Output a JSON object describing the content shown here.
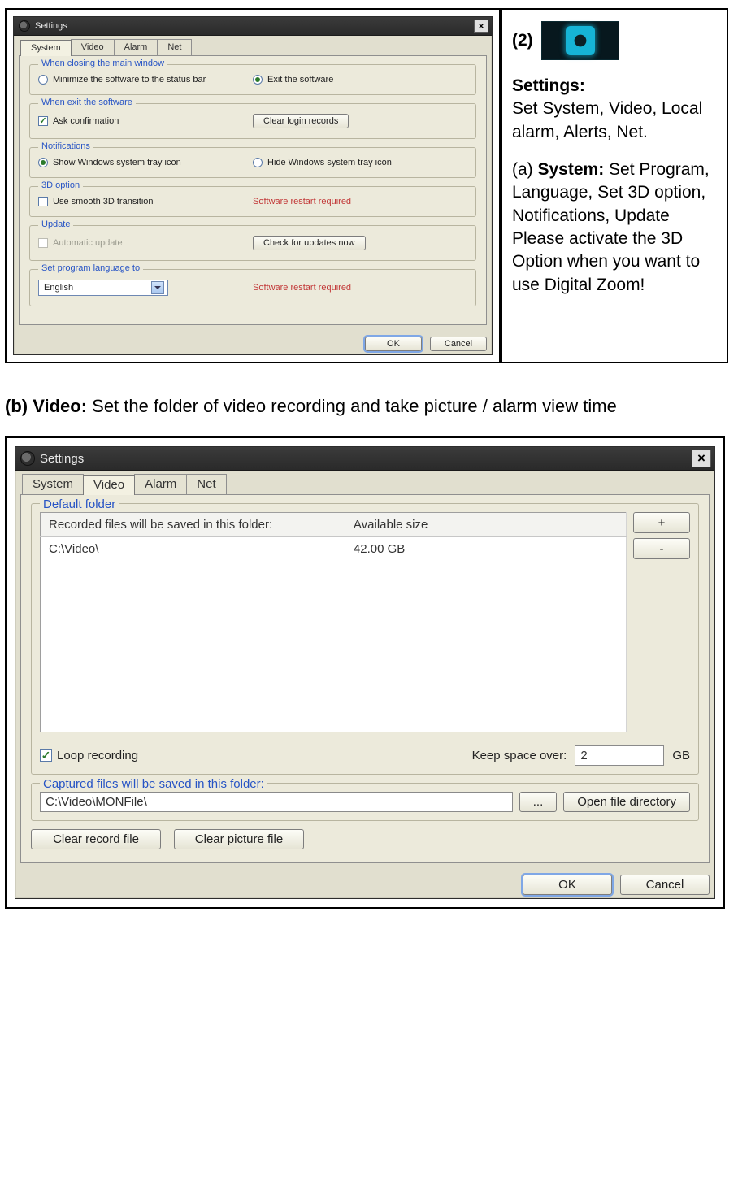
{
  "doc": {
    "item_num": "(2)",
    "settings_heading": "Settings:",
    "settings_line": "Set System, Video, Local alarm, Alerts, Net.",
    "system_label_a": "(a)  ",
    "system_bold": "System:",
    "system_rest": " Set Program, Language, Set 3D option, Notifications, Update Please activate the 3D Option when you want to use Digital Zoom!",
    "caption_b_prefix": "(b) Video:",
    "caption_b_rest": " Set the folder of video recording and take picture / alarm view time"
  },
  "win": {
    "title": "Settings",
    "close": "×",
    "ok": "OK",
    "cancel": "Cancel",
    "tabs": {
      "system": "System",
      "video": "Video",
      "alarm": "Alarm",
      "net": "Net"
    }
  },
  "system": {
    "g_close": "When closing the main window",
    "close_min": "Minimize the software to the status bar",
    "close_exit": "Exit the software",
    "g_exit": "When exit the software",
    "ask_confirm": "Ask confirmation",
    "clear_login": "Clear login records",
    "g_notif": "Notifications",
    "show_tray": "Show Windows system tray icon",
    "hide_tray": "Hide Windows system tray icon",
    "g_3d": "3D option",
    "smooth3d": "Use smooth 3D transition",
    "restart": "Software restart required",
    "g_update": "Update",
    "auto_update": "Automatic update",
    "check_update": "Check for updates now",
    "g_lang": "Set program language to",
    "lang_value": "English"
  },
  "video": {
    "g_default": "Default folder",
    "col_path": "Recorded files will be saved in this folder:",
    "col_size": "Available size",
    "row_path": "C:\\Video\\",
    "row_size": "42.00 GB",
    "add": "+",
    "remove": "-",
    "loop": "Loop recording",
    "keep_label": "Keep space over:",
    "keep_value": "2",
    "keep_unit": "GB",
    "g_capture": "Captured files will be saved in this folder:",
    "capture_path": "C:\\Video\\MONFile\\",
    "browse": "...",
    "open_dir": "Open file directory",
    "clear_record": "Clear record file",
    "clear_picture": "Clear picture file"
  }
}
